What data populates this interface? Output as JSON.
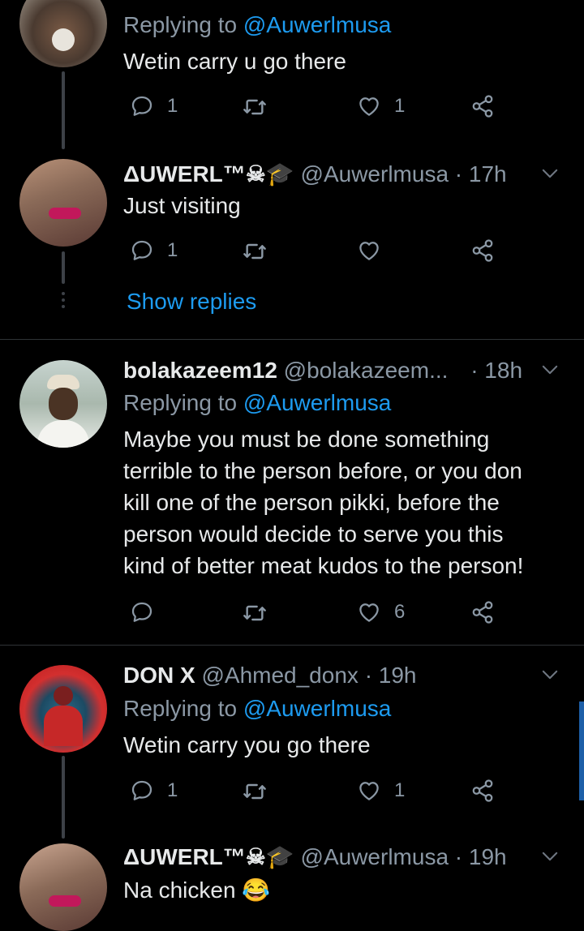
{
  "tweets": [
    {
      "replying_prefix": "Replying to",
      "replying_to": "@Auwerlmusa",
      "text": "Wetin carry u go there",
      "reply_count": "1",
      "like_count": "1"
    },
    {
      "name": "ΔUWERL™☠🎓",
      "handle": "@Auwerlmusa",
      "time": "· 17h",
      "text": "Just visiting",
      "reply_count": "1",
      "like_count": ""
    },
    {
      "name": "bolakazeem12",
      "handle": "@bolakazeem...",
      "time": "· 18h",
      "replying_prefix": "Replying to",
      "replying_to": "@Auwerlmusa",
      "text_lines": [
        "Maybe you must be done something",
        "terrible to the person before, or you don",
        "kill one of the person pikki, before the",
        "person would decide to serve you this",
        "kind of better meat kudos to the person!"
      ],
      "reply_count": "",
      "like_count": "6"
    },
    {
      "name": "DON X",
      "handle": "@Ahmed_donx",
      "time": "· 19h",
      "replying_prefix": "Replying to",
      "replying_to": "@Auwerlmusa",
      "text": "Wetin carry you go there",
      "reply_count": "1",
      "like_count": "1"
    },
    {
      "name": "ΔUWERL™☠🎓",
      "handle": "@Auwerlmusa",
      "time": "· 19h",
      "text": "Na chicken 😂"
    }
  ],
  "show_replies": "Show replies",
  "icons": [
    "reply-icon",
    "retweet-icon",
    "like-icon",
    "share-icon",
    "chevron-down-icon"
  ],
  "colors": {
    "accent": "#1d9bf0",
    "secondary_text": "#8b98a5",
    "background": "#000000"
  }
}
